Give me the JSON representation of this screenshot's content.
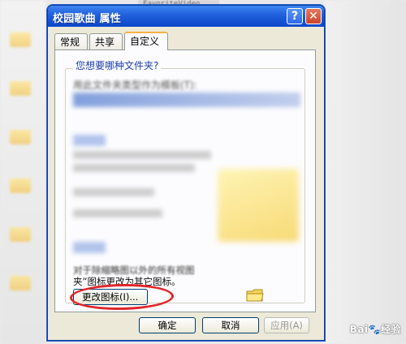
{
  "background": {
    "top_text": "FavoriteVideo"
  },
  "dialog": {
    "title": "校园歌曲 属性",
    "help_glyph": "?",
    "close_glyph": "✕"
  },
  "tabs": [
    {
      "label": "常规"
    },
    {
      "label": "共享"
    },
    {
      "label": "自定义"
    }
  ],
  "custom_tab": {
    "question_heading": "您想要哪种文件夹?",
    "template_label": "用此文件夹类型作为模板(T):",
    "icons_description": "对于除缩略图以外的所有视图,可以将标准的“文件夹”图标更改为其它图标。",
    "icons_description_line1": "对于除缩略图以外的所有视图",
    "icons_description_line2": "夹”图标更改为其它图标。",
    "change_icon_button": "更改图标(I)..."
  },
  "footer": {
    "ok": "确定",
    "cancel": "取消",
    "apply": "应用(A)"
  },
  "watermark": {
    "text": "Bai",
    "paw": "🐾",
    "suffix": "经验"
  },
  "colors": {
    "titlebar": "#1f5fdb",
    "annotation": "#e1262a",
    "dialog_bg": "#ece9d8"
  }
}
